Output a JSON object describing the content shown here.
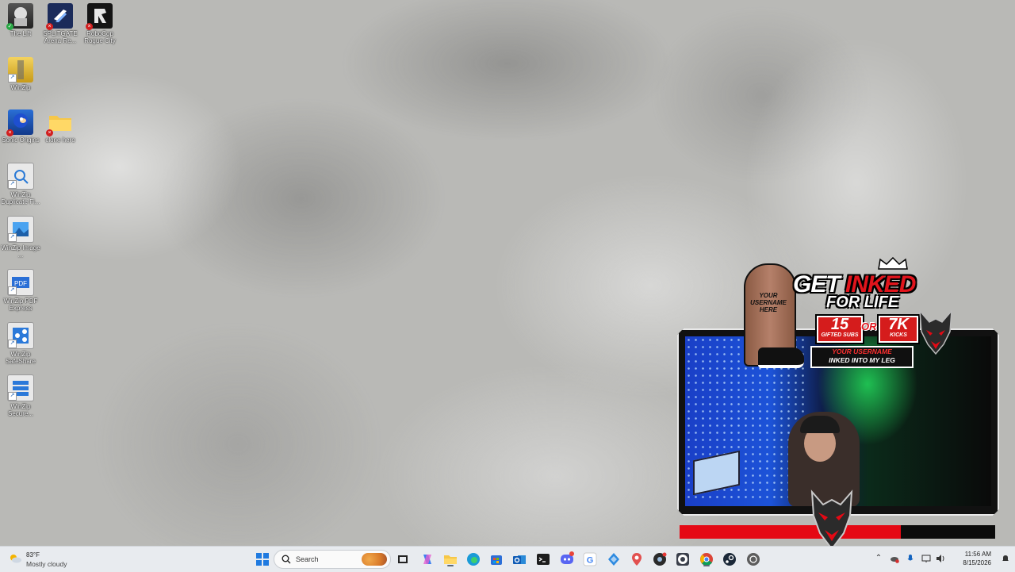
{
  "desktop": {
    "icons": [
      {
        "label": "The Lift",
        "icon": "game-the-lift-icon",
        "status": "synced"
      },
      {
        "label": "SPLITGATE Arena Re...",
        "icon": "game-splitgate-icon",
        "status": "error"
      },
      {
        "label": "RoboCop Rogue City",
        "icon": "game-robocop-icon",
        "status": "error"
      },
      {
        "label": "WinZip",
        "icon": "winzip-icon",
        "status": "shortcut"
      },
      {
        "label": "Sonic Origins",
        "icon": "game-sonic-icon",
        "status": "error"
      },
      {
        "label": "clone hero",
        "icon": "folder-icon",
        "status": "error"
      },
      {
        "label": "WinZip Duplicate Fi...",
        "icon": "winzip-duplicate-icon",
        "status": "shortcut"
      },
      {
        "label": "WinZip Image ...",
        "icon": "winzip-image-icon",
        "status": "shortcut"
      },
      {
        "label": "WinZip PDF Express",
        "icon": "winzip-pdf-icon",
        "status": "shortcut"
      },
      {
        "label": "WinZip SafeShare",
        "icon": "winzip-safeshare-icon",
        "status": "shortcut"
      },
      {
        "label": "WinZip Secure...",
        "icon": "winzip-secure-icon",
        "status": "shortcut"
      }
    ]
  },
  "overlay": {
    "promo": {
      "leg_text": "YOUR USERNAME HERE",
      "title_word1": "GET",
      "title_word2": "INKED",
      "subtitle": "FOR LIFE",
      "box1_big": "15",
      "box1_small": "GIFTED SUBS",
      "or_text": "OR",
      "box2_big": "7K",
      "box2_small": "KICKS",
      "banner_line1": "YOUR USERNAME",
      "banner_line2": "INKED INTO MY LEG"
    },
    "progress": {
      "value": 0.7
    },
    "colors": {
      "accent": "#e50914",
      "track": "#0b0b0b"
    }
  },
  "taskbar": {
    "weather": {
      "temp": "83°F",
      "condition": "Mostly cloudy",
      "icon": "partly-cloudy-icon"
    },
    "search": {
      "placeholder": "Search"
    },
    "apps": [
      {
        "icon": "windows-start-icon"
      },
      {
        "icon": "search-icon"
      },
      {
        "icon": "task-view-icon"
      },
      {
        "icon": "copilot-icon"
      },
      {
        "icon": "file-explorer-icon"
      },
      {
        "icon": "edge-browser-icon"
      },
      {
        "icon": "microsoft-store-icon"
      },
      {
        "icon": "outlook-icon"
      },
      {
        "icon": "terminal-icon"
      },
      {
        "icon": "discord-icon"
      },
      {
        "icon": "google-icon"
      },
      {
        "icon": "app-diamond-icon"
      },
      {
        "icon": "maps-pin-icon"
      },
      {
        "icon": "app-dark-circle-icon"
      },
      {
        "icon": "obs-studio-icon"
      },
      {
        "icon": "chrome-icon"
      },
      {
        "icon": "steam-icon"
      },
      {
        "icon": "steam-alt-icon"
      }
    ],
    "tray": {
      "icons": [
        "chevron-up-icon",
        "onedrive-icon",
        "microphone-icon",
        "network-icon",
        "volume-icon",
        "notification-icon"
      ],
      "time": "11:56 AM",
      "date": "8/15/2026"
    }
  }
}
